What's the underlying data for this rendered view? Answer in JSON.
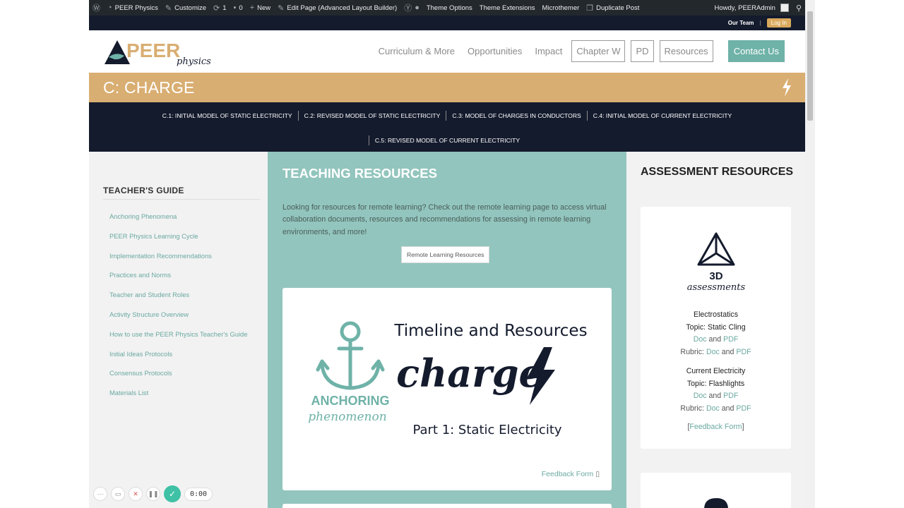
{
  "admin_bar": {
    "site": "PEER Physics",
    "customize": "Customize",
    "updates": "1",
    "comments": "0",
    "new": "New",
    "edit_page": "Edit Page (Advanced Layout Builder)",
    "theme_options": "Theme Options",
    "theme_extensions": "Theme Extensions",
    "microthemer": "Microthemer",
    "duplicate_post": "Duplicate Post",
    "howdy": "Howdy, PEERAdmin"
  },
  "top_links": {
    "our_team": "Our Team",
    "login": "Log In"
  },
  "logo": {
    "text_main": "PEER",
    "text_sub": "physics"
  },
  "nav": {
    "curriculum": "Curriculum & More",
    "opportunities": "Opportunities",
    "impact": "Impact",
    "chapter_w": "Chapter W",
    "pd": "PD",
    "resources": "Resources",
    "contact": "Contact Us"
  },
  "chapter": {
    "title": "C: CHARGE"
  },
  "subnav": {
    "items": [
      "C.1: INITIAL MODEL OF STATIC ELECTRICITY",
      "C.2: REVISED MODEL OF STATIC ELECTRICITY",
      "C.3: MODEL OF CHARGES IN CONDUCTORS",
      "C.4: INITIAL MODEL OF CURRENT ELECTRICITY",
      "C.5: REVISED MODEL OF CURRENT ELECTRICITY"
    ]
  },
  "teachers_guide": {
    "heading": "TEACHER'S GUIDE",
    "items": [
      "Anchoring Phenomena",
      "PEER Physics Learning Cycle",
      "Implementation Recommendations",
      "Practices and Norms",
      "Teacher and Student Roles",
      "Activity Structure Overview",
      "How to use the PEER Physics Teacher's Guide",
      "Initial Ideas Protocols",
      "Consensus Protocols",
      "Materials List"
    ]
  },
  "teaching": {
    "title": "TEACHING RESOURCES",
    "intro": "Looking for resources for remote learning?  Check out the remote learning page to access virtual collaboration documents, resources and recommendations for assessing in remote learning environments, and more!",
    "remote_button": "Remote Learning Resources",
    "card": {
      "anchoring_1": "ANCHORING",
      "anchoring_2": "phenomenon",
      "timeline": "Timeline and Resources",
      "charge": "charge",
      "part": "Part  1: Static Electricity",
      "feedback": "Feedback Form"
    }
  },
  "assessment": {
    "title": "ASSESSMENT RESOURCES",
    "logo_1": "3D",
    "logo_2": "assessments",
    "electrostatics": "Electrostatics",
    "topic_static": "Topic: Static Cling",
    "doc": "Doc",
    "and": "and",
    "pdf": "PDF",
    "rubric": "Rubric:",
    "current": "Current Electricity",
    "topic_flash": "Topic: Flashlights",
    "feedback": "Feedback Form",
    "bracket_open": "[",
    "bracket_close": "]"
  },
  "recorder": {
    "time": "0:00"
  },
  "colors": {
    "navy": "#141b2d",
    "gold": "#d9ae72",
    "teal": "#6fb2a8",
    "teal_bg": "#92c5bd"
  }
}
